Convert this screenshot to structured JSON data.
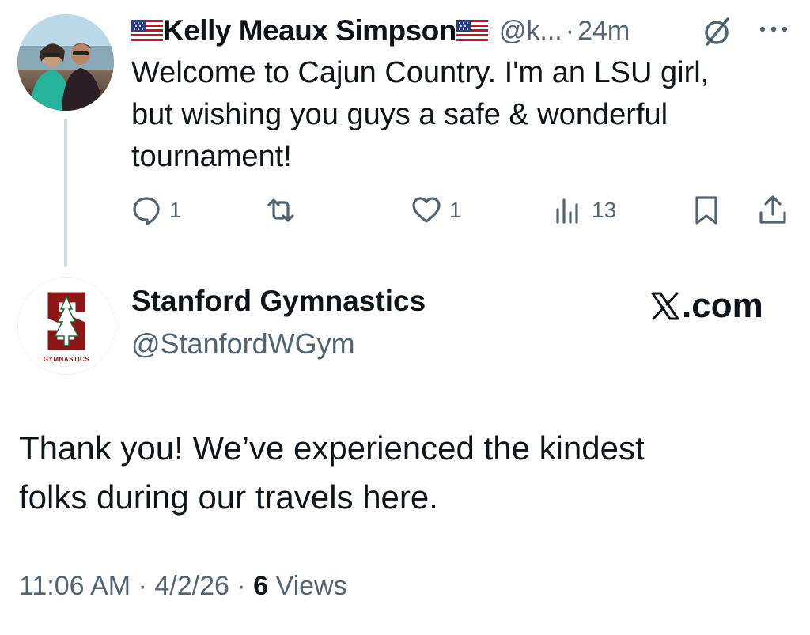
{
  "reply": {
    "display_name": "Kelly Meaux Simpson",
    "handle": "@k...",
    "separator": "·",
    "time": "24m",
    "text_lines": [
      "Welcome to Cajun Country.  I'm an LSU girl,",
      "but wishing you guys a safe & wonderful",
      "tournament!"
    ],
    "actions": {
      "replies": "1",
      "retweets": "",
      "likes": "1",
      "views": "13"
    }
  },
  "quoted": {
    "display_name": "Stanford Gymnastics",
    "handle": "@StanfordWGym",
    "source": ".com",
    "avatar_logo_text": "GYMNASTICS",
    "text_lines": [
      "Thank you! We’ve experienced the kindest",
      "folks during our travels here."
    ],
    "timestamp": "11:06 AM",
    "date": "4/2/26",
    "separator": "·",
    "views_count": "6",
    "views_label": "Views"
  },
  "colors": {
    "text_primary": "#0f1419",
    "text_secondary": "#536471",
    "stanford_red": "#8c1515",
    "thread_line": "#cfd9de"
  }
}
